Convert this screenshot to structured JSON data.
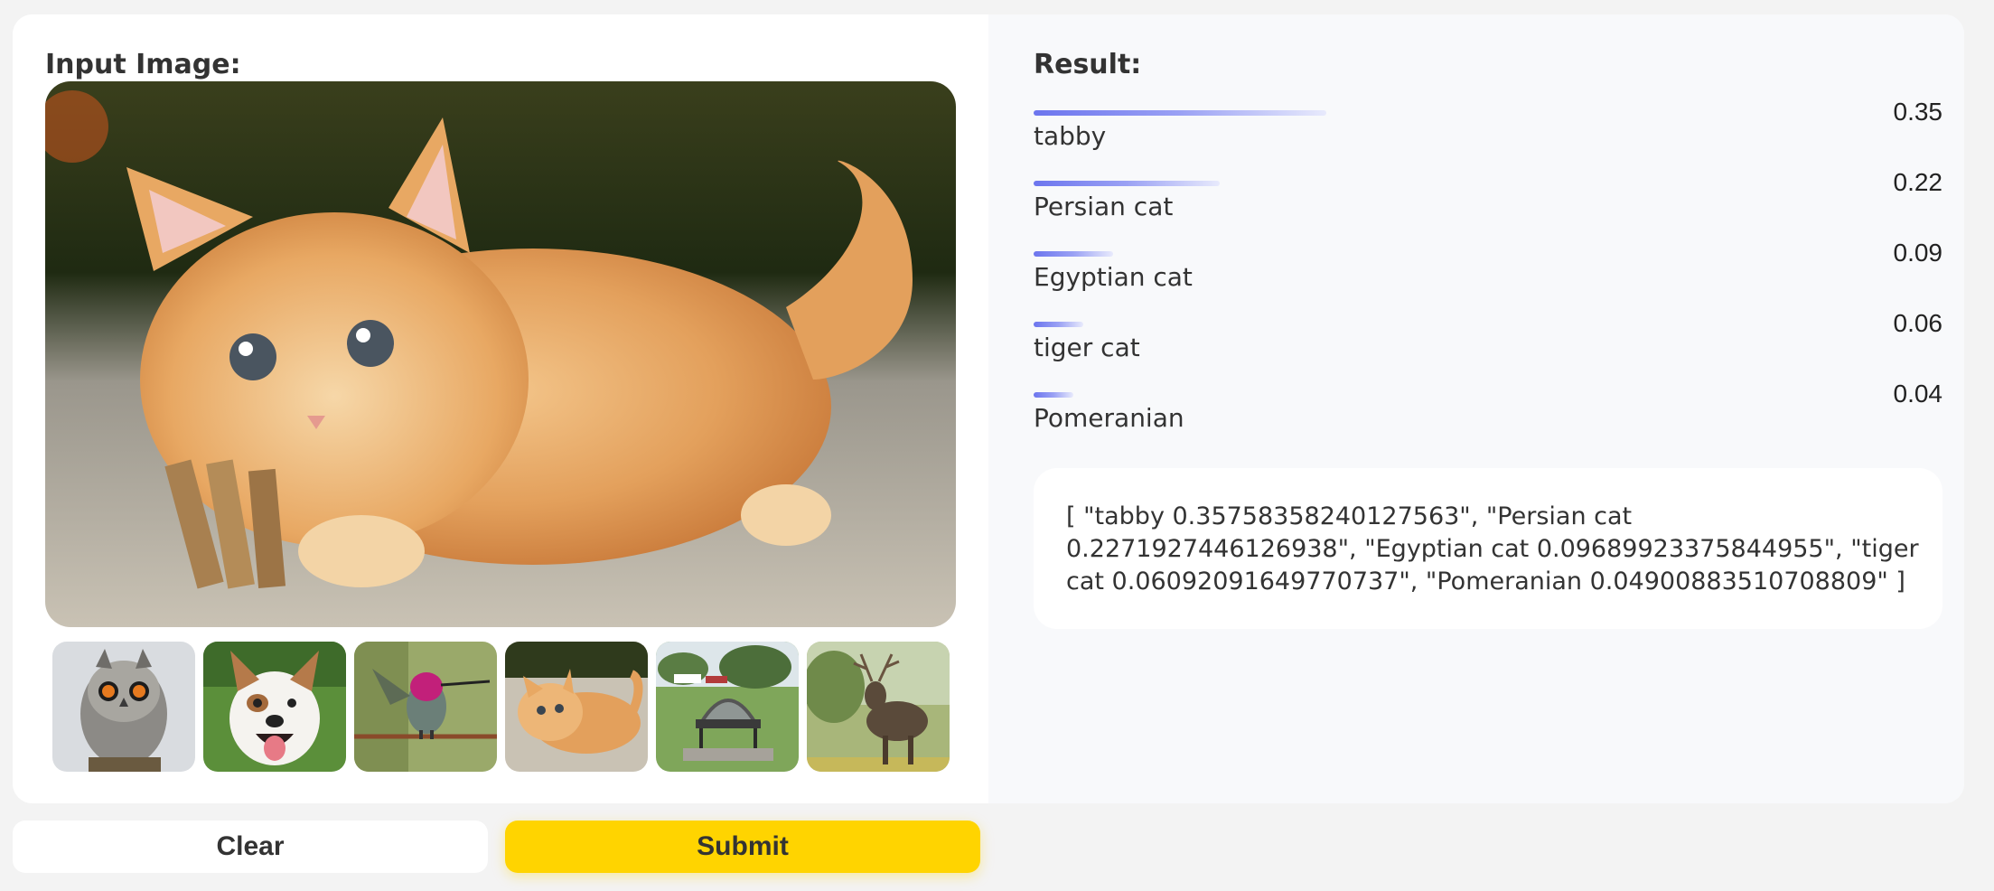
{
  "input": {
    "label": "Input Image:",
    "image_icon": "kitten-photo"
  },
  "examples": [
    {
      "icon": "owl-thumbnail"
    },
    {
      "icon": "dog-thumbnail"
    },
    {
      "icon": "hummingbird-thumbnail"
    },
    {
      "icon": "kitten-thumbnail"
    },
    {
      "icon": "bench-thumbnail"
    },
    {
      "icon": "deer-thumbnail"
    }
  ],
  "result": {
    "label": "Result:",
    "items": [
      {
        "name": "tabby",
        "score": "0.35",
        "fraction": 0.358
      },
      {
        "name": "Persian cat",
        "score": "0.22",
        "fraction": 0.227
      },
      {
        "name": "Egyptian cat",
        "score": "0.09",
        "fraction": 0.097
      },
      {
        "name": "tiger cat",
        "score": "0.06",
        "fraction": 0.061
      },
      {
        "name": "Pomeranian",
        "score": "0.04",
        "fraction": 0.049
      }
    ],
    "json_output": "[ \"tabby 0.35758358240127563\", \"Persian cat 0.2271927446126938\", \"Egyptian cat 0.09689923375844955\", \"tiger cat 0.06092091649770737\", \"Pomeranian 0.04900883510708809\" ]"
  },
  "buttons": {
    "clear_label": "Clear",
    "submit_label": "Submit"
  },
  "colors": {
    "submit": "#ffd400",
    "bar_start": "#6c75ee",
    "bar_end": "#e8eafc"
  }
}
